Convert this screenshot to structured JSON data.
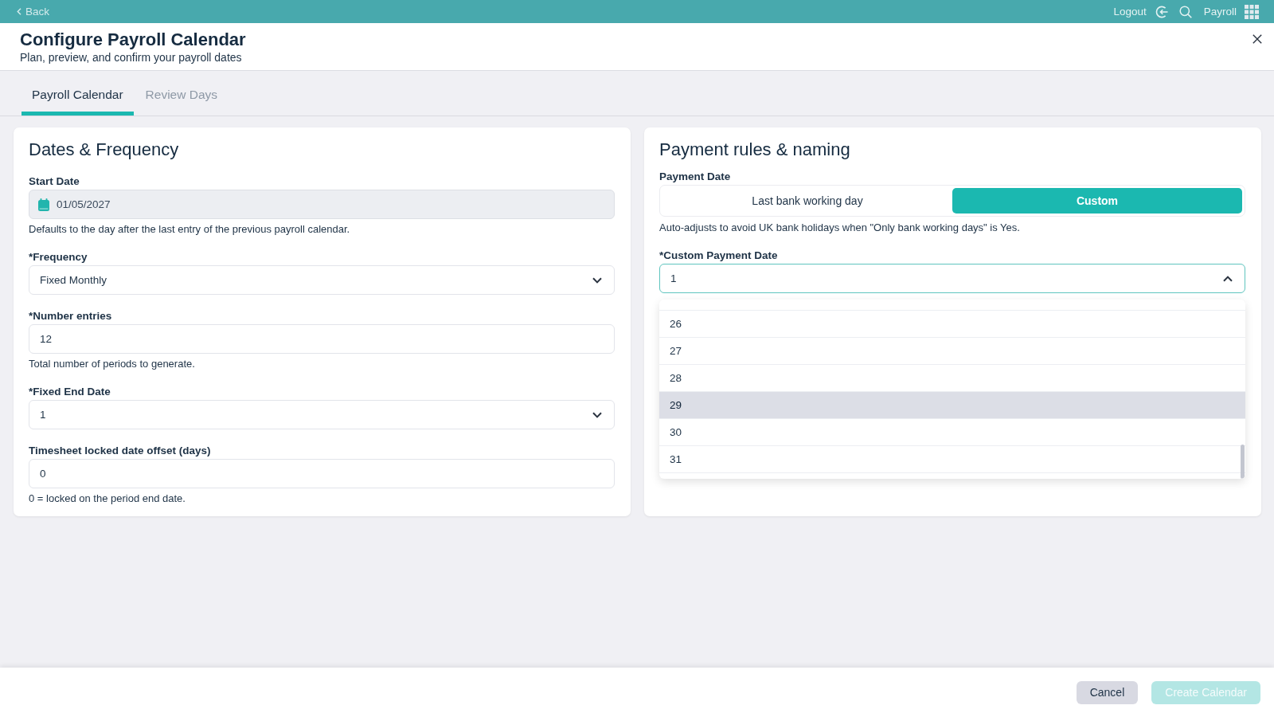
{
  "top_bar": {
    "back_label": "Back",
    "logout_label": "Logout",
    "app_label": "Payroll"
  },
  "header": {
    "title": "Configure Payroll Calendar",
    "subtitle": "Plan, preview, and confirm your payroll dates"
  },
  "tabs": [
    {
      "label": "Payroll Calendar",
      "selected": true
    },
    {
      "label": "Review Days",
      "selected": false
    }
  ],
  "dates_card": {
    "title": "Dates & Frequency",
    "fields": [
      {
        "kind": "date",
        "label": "Start Date",
        "value": "01/05/2027",
        "disabled": true,
        "hint": "Defaults to the day after the last entry of the previous payroll calendar."
      },
      {
        "kind": "select",
        "label": "*Frequency",
        "value": "Fixed Monthly",
        "disabled": false,
        "expanded": false
      },
      {
        "kind": "input",
        "label": "*Number entries",
        "value": "12",
        "disabled": false,
        "hint": "Total number of periods to generate."
      },
      {
        "kind": "select",
        "label": "*Fixed End Date",
        "value": "1",
        "disabled": false,
        "expanded": false
      },
      {
        "kind": "input",
        "label": "Timesheet locked date offset (days)",
        "value": "0",
        "disabled": false,
        "hint": "0 = locked on the period end date."
      }
    ]
  },
  "payment_card": {
    "title": "Payment rules & naming",
    "payment_date": {
      "label": "Payment Date",
      "options": [
        {
          "label": "Last bank working day",
          "selected": false
        },
        {
          "label": "Custom",
          "selected": true
        }
      ],
      "hint": "Auto-adjusts to avoid UK bank holidays when \"Only bank working days\" is Yes."
    },
    "custom_payment_date": {
      "label": "*Custom Payment Date",
      "value": "1",
      "expanded": true,
      "options": [
        {
          "label": "26",
          "highlighted": false
        },
        {
          "label": "27",
          "highlighted": false
        },
        {
          "label": "28",
          "highlighted": false
        },
        {
          "label": "29",
          "highlighted": true
        },
        {
          "label": "30",
          "highlighted": false
        },
        {
          "label": "31",
          "highlighted": false
        }
      ]
    }
  },
  "footer": {
    "buttons": [
      {
        "label": "Cancel",
        "kind": "secondary",
        "disabled": false
      },
      {
        "label": "Create Calendar",
        "kind": "primary",
        "disabled": true
      }
    ]
  }
}
